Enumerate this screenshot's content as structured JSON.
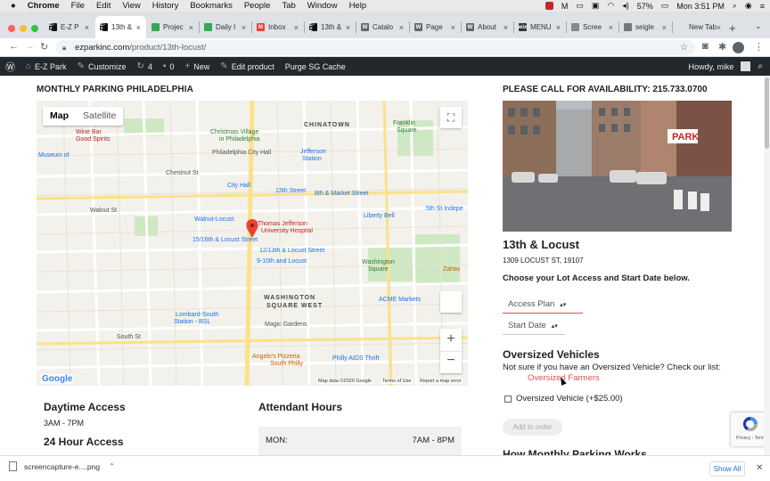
{
  "mac_menu": {
    "apple": "",
    "items": [
      "Chrome",
      "File",
      "Edit",
      "View",
      "History",
      "Bookmarks",
      "People",
      "Tab",
      "Window",
      "Help"
    ],
    "battery": "57%",
    "clock": "Mon 3:51 PM"
  },
  "tabs": [
    {
      "label": "E-Z P",
      "fav": "E-Z",
      "fav_color": "#111"
    },
    {
      "label": "13th &",
      "fav": "E-Z",
      "fav_color": "#111",
      "active": true
    },
    {
      "label": "Projec",
      "fav": "",
      "fav_color": "#34a853"
    },
    {
      "label": "Daily I",
      "fav": "",
      "fav_color": "#34a853"
    },
    {
      "label": "Inbox",
      "fav": "M",
      "fav_color": "#ea4335"
    },
    {
      "label": "13th &",
      "fav": "E-Z",
      "fav_color": "#111"
    },
    {
      "label": "Catalo",
      "fav": "W",
      "fav_color": "#666"
    },
    {
      "label": "Page",
      "fav": "W",
      "fav_color": "#666"
    },
    {
      "label": "About",
      "fav": "W",
      "fav_color": "#666"
    },
    {
      "label": "MENU",
      "fav": "wix",
      "fav_color": "#333"
    },
    {
      "label": "Scree",
      "fav": "",
      "fav_color": "#888"
    },
    {
      "label": "seigle",
      "fav": "",
      "fav_color": "#777"
    },
    {
      "label": "New Tab",
      "fav": "",
      "fav_color": "#dee1e6"
    }
  ],
  "address": {
    "host": "ezparkinc.com",
    "path": "/product/13th-locust/"
  },
  "wp_admin": {
    "site": "E-Z Park",
    "customize": "Customize",
    "updates": "4",
    "comments": "0",
    "new": "New",
    "edit": "Edit product",
    "purge": "Purge SG Cache",
    "howdy": "Howdy, mike"
  },
  "map": {
    "heading": "MONTHLY PARKING PHILADELPHIA",
    "btn_map": "Map",
    "btn_satellite": "Satellite",
    "labels": [
      {
        "t": "Christmas Village",
        "c": "g"
      },
      {
        "t": "in Philadelphia",
        "c": "g"
      },
      {
        "t": "CHINATOWN",
        "c": "d"
      },
      {
        "t": "Franklin",
        "c": "g"
      },
      {
        "t": "Square",
        "c": "g"
      },
      {
        "t": "Philadelphia City Hall",
        "c": ""
      },
      {
        "t": "Jefferson",
        "c": "b"
      },
      {
        "t": "Station",
        "c": "b"
      },
      {
        "t": "City Hall",
        "c": "b"
      },
      {
        "t": "13th Street",
        "c": "b"
      },
      {
        "t": "8th & Market Street",
        "c": "b"
      },
      {
        "t": "Walnut-Locust",
        "c": "b"
      },
      {
        "t": "Thomas Jefferson",
        "c": "r"
      },
      {
        "t": "University Hospital",
        "c": "r"
      },
      {
        "t": "15/16th & Locust Street",
        "c": "b"
      },
      {
        "t": "12/13th & Locust Street",
        "c": "b"
      },
      {
        "t": "9-10th and Locust",
        "c": "b"
      },
      {
        "t": "Liberty Bell",
        "c": "b"
      },
      {
        "t": "5th St Indepe",
        "c": "b"
      },
      {
        "t": "Washington",
        "c": "g"
      },
      {
        "t": "Square",
        "c": "g"
      },
      {
        "t": "WASHINGTON",
        "c": "d"
      },
      {
        "t": "SQUARE WEST",
        "c": "d"
      },
      {
        "t": "ACME Markets",
        "c": "b"
      },
      {
        "t": "Lombard-South",
        "c": "b"
      },
      {
        "t": "Station - BSL",
        "c": "b"
      },
      {
        "t": "Magic Gardens",
        "c": ""
      },
      {
        "t": "Angelo's Pizzeria",
        "c": "o"
      },
      {
        "t": "South Philly",
        "c": "o"
      },
      {
        "t": "Philly AIDS Thrift",
        "c": "b"
      },
      {
        "t": "Museum of",
        "c": "b"
      },
      {
        "t": "Wine Bar",
        "c": "r"
      },
      {
        "t": "Good Spirits",
        "c": "r"
      },
      {
        "t": "Chestnut St",
        "c": ""
      },
      {
        "t": "Walnut St",
        "c": ""
      },
      {
        "t": "South St",
        "c": ""
      },
      {
        "t": "Zahav",
        "c": "o"
      }
    ],
    "footer_data": "Map data ©2020 Google",
    "footer_terms": "Terms of Use",
    "footer_report": "Report a map error",
    "google": "Google"
  },
  "product": {
    "availability_prefix": "PLEASE CALL FOR AVAILABILITY:",
    "phone": "215.733.0700",
    "name": "13th & Locust",
    "address": "1309 LOCUST ST, 19107",
    "instructions": "Choose your Lot Access and Start Date below.",
    "access_placeholder": "Access Plan",
    "date_placeholder": "Start Date",
    "oversized_heading": "Oversized Vehicles",
    "oversized_text": "Not sure if you have an Oversized Vehicle? Check our list:",
    "oversized_link": "Oversized Farmers",
    "oversized_checkbox": "Oversized Vehicle (+$25.00)",
    "add_to_order": "Add to order",
    "cut_heading": "How Monthly Parking Works"
  },
  "hours": {
    "daytime_title": "Daytime Access",
    "daytime_value": "3AM - 7PM",
    "h24_title": "24 Hour Access",
    "attendant_title": "Attendant Hours",
    "rows": [
      {
        "day": "MON:",
        "time": "7AM - 8PM"
      }
    ]
  },
  "recaptcha": {
    "text": "Privacy - Terms"
  },
  "downloads": {
    "file": "screencapture-e....png",
    "show_all": "Show All"
  },
  "colors": {
    "wp_bar": "#23282d",
    "accent_red": "#d9534f",
    "link_blue": "#1a73e8"
  }
}
